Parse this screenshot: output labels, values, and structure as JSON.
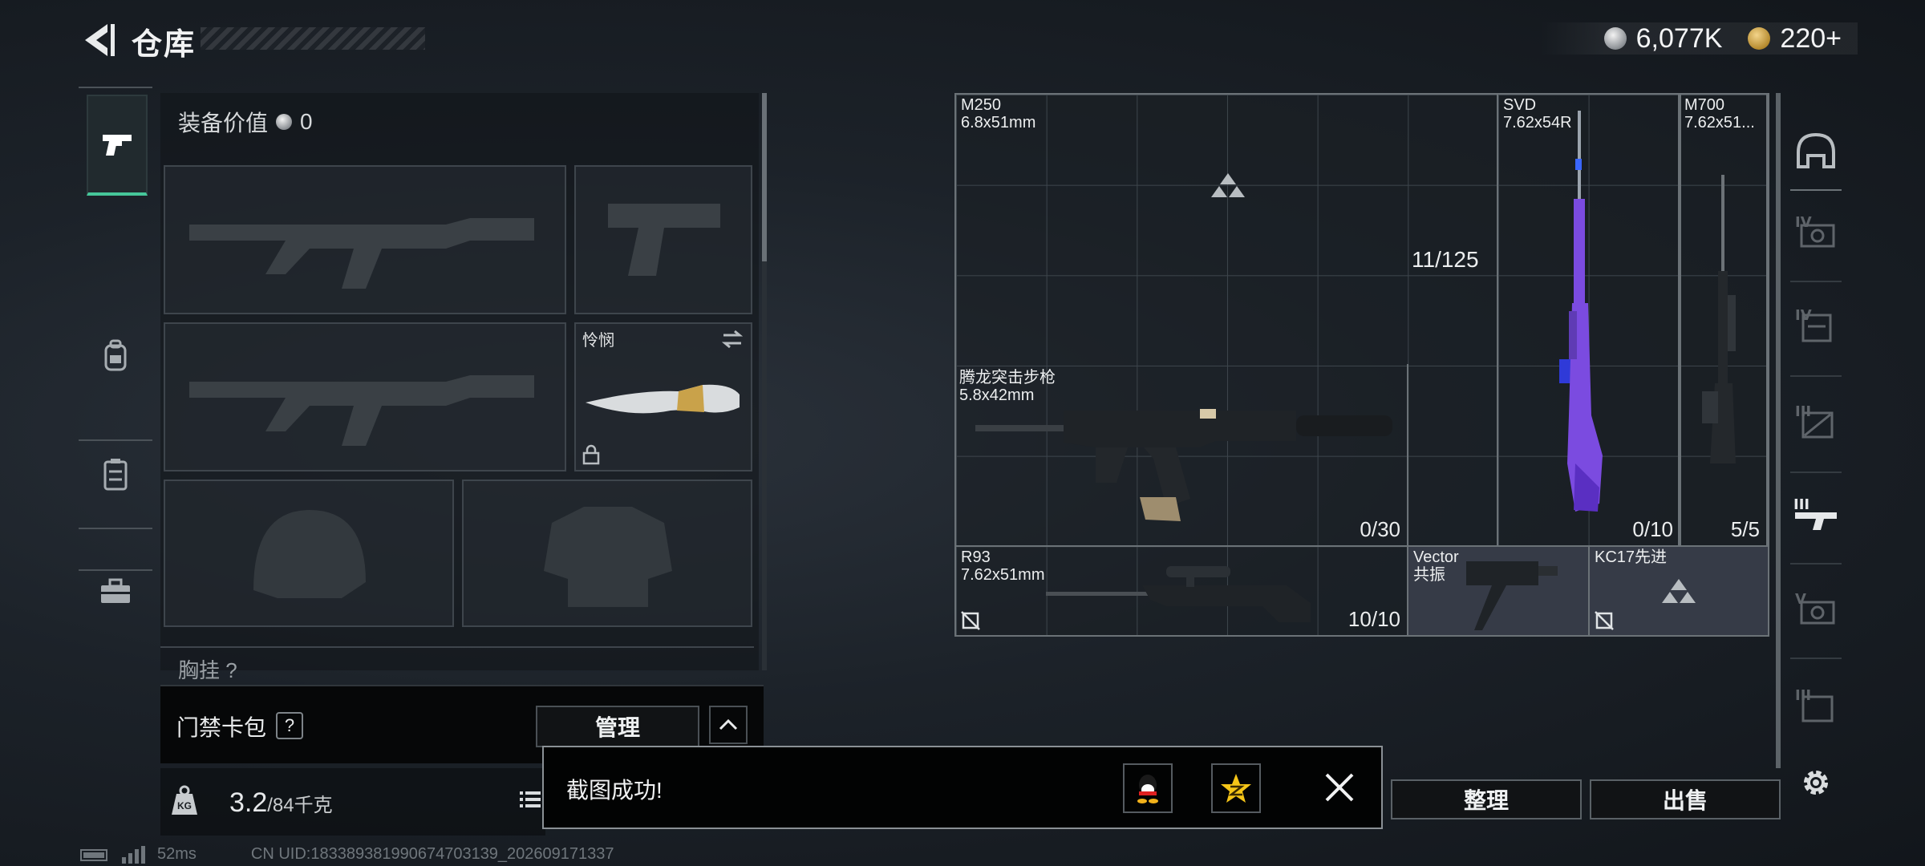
{
  "header": {
    "title": "仓库",
    "currencies": [
      {
        "icon": "silver-coin-icon",
        "value": "6,077K"
      },
      {
        "icon": "gold-coin-icon",
        "value": "220",
        "suffix": "+"
      }
    ]
  },
  "left_tabs": [
    {
      "icon": "pistol-icon",
      "active": true
    },
    {
      "icon": "backpack-icon",
      "active": false
    },
    {
      "icon": "vest-icon",
      "active": false
    },
    {
      "icon": "toolbox-icon",
      "active": false
    }
  ],
  "equipment": {
    "value_label": "装备价值",
    "value": "0",
    "knife_slot": {
      "label": "怜悯"
    },
    "chest_hint": "胸挂",
    "chest_hint_mark": "?"
  },
  "card_pack": {
    "label": "门禁卡包",
    "help": "?",
    "manage_label": "管理"
  },
  "weight": {
    "current": "3.2",
    "max": "/84千克",
    "kg_label": "KG"
  },
  "status": {
    "ping": "52ms",
    "uid": "CN UID:18338938199067470313​9_202609171337"
  },
  "grid": {
    "capacity": "11/125",
    "weapons": [
      {
        "name": "M250",
        "caliber": "6.8x51mm",
        "count": ""
      },
      {
        "name": "SVD",
        "caliber": "7.62x54R",
        "count": "0/10"
      },
      {
        "name": "M700",
        "caliber": "7.62x51...",
        "count": "5/5"
      },
      {
        "name": "腾龙突击步枪",
        "caliber": "5.8x42mm",
        "count": "0/30"
      },
      {
        "name": "R93",
        "caliber": "7.62x51mm",
        "count": "10/10"
      },
      {
        "name": "Vector",
        "caliber": "共振",
        "count": ""
      },
      {
        "name": "KC17先进",
        "caliber": "",
        "count": ""
      }
    ]
  },
  "actions": {
    "sort_label": "整理",
    "sell_label": "出售"
  },
  "toast": {
    "message": "截图成功!",
    "share_icons": [
      "qq-icon",
      "qzone-star-icon"
    ]
  },
  "colors": {
    "accent_green": "#46c79a",
    "svd_purple": "#7b4be0"
  }
}
